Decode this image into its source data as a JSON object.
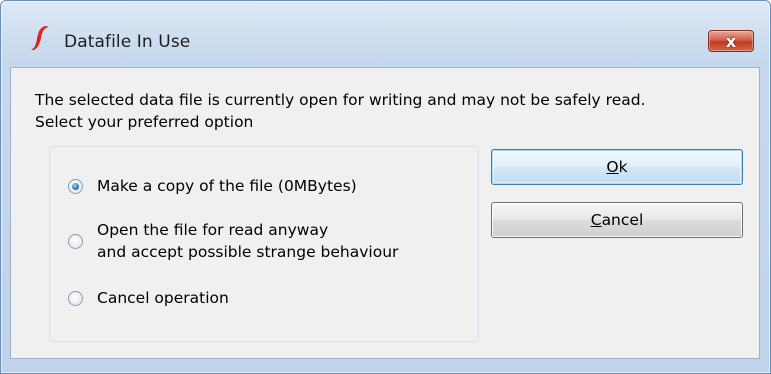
{
  "window": {
    "title": "Datafile In Use",
    "close_label": "x"
  },
  "message": {
    "line1": "The selected data file is currently open for writing and may not be safely read.",
    "line2": "Select your preferred option"
  },
  "options": [
    {
      "line1": "Make a copy of the file (0MBytes)",
      "line2": "",
      "checked": true
    },
    {
      "line1": "Open the file for read anyway",
      "line2": "and accept possible strange behaviour",
      "checked": false
    },
    {
      "line1": "Cancel operation",
      "line2": "",
      "checked": false
    }
  ],
  "buttons": {
    "ok": {
      "accel": "O",
      "rest": "k"
    },
    "cancel": {
      "accel": "C",
      "rest": "ancel"
    }
  },
  "colors": {
    "accent": "#3c7fb1",
    "close": "#c0391f",
    "app_icon": "#e0201b"
  }
}
